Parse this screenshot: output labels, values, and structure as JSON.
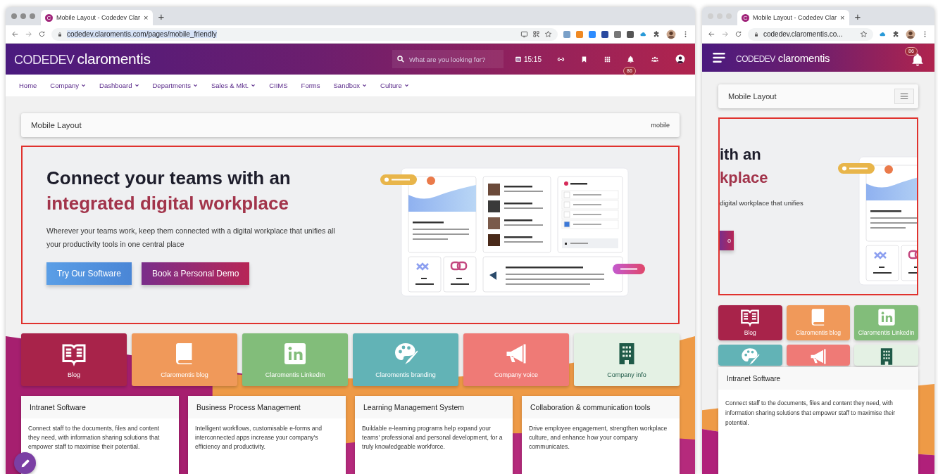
{
  "windows": [
    {
      "kind": "desktop",
      "tab": {
        "favicon": "C",
        "title": "Mobile Layout - Codedev Clar",
        "close": "×",
        "selected": true
      },
      "new_tab": "+",
      "url": "codedev.claromentis.com/pages/mobile_friendly",
      "header": {
        "logo_prefix": "CODEDEV",
        "logo_name": "claromentis",
        "search_placeholder": "What are you looking for?",
        "clock": "15:15",
        "badge": "86"
      },
      "nav": [
        {
          "label": "Home",
          "dropdown": false
        },
        {
          "label": "Company",
          "dropdown": true
        },
        {
          "label": "Dashboard",
          "dropdown": true
        },
        {
          "label": "Departments",
          "dropdown": true
        },
        {
          "label": "Sales & Mkt.",
          "dropdown": true
        },
        {
          "label": "CIIMS",
          "dropdown": false
        },
        {
          "label": "Forms",
          "dropdown": false
        },
        {
          "label": "Sandbox",
          "dropdown": true
        },
        {
          "label": "Culture",
          "dropdown": true
        }
      ],
      "page_header": {
        "title": "Mobile Layout",
        "tag": "mobile"
      },
      "hero": {
        "heading": [
          "Connect your teams with an",
          "integrated digital workplace"
        ],
        "text": "Wherever your teams work, keep them connected with a digital workplace that unifies all your productivity tools in one central place",
        "buttons": [
          {
            "label": "Try Our Software",
            "kind": "primary"
          },
          {
            "label": "Book a Personal Demo",
            "kind": "accent"
          }
        ]
      },
      "tiles": [
        {
          "label": "Blog",
          "color": "#a8234a"
        },
        {
          "label": "Claromentis blog",
          "color": "#f0995a"
        },
        {
          "label": "Claromentis LinkedIn",
          "color": "#82bd7a"
        },
        {
          "label": "Claromentis branding",
          "color": "#62b3b6"
        },
        {
          "label": "Company voice",
          "color": "#ef7a76"
        },
        {
          "label": "Company info",
          "color": "#e4f1e4"
        }
      ],
      "cards": [
        {
          "title": "Intranet Software",
          "text": "Connect staff to the documents, files and content they need, with information sharing solutions that empower staff to maximise their potential."
        },
        {
          "title": "Business Process Management",
          "text": "Intelligent workflows, customisable e-forms and interconnected apps increase your company's efficiency and productivity."
        },
        {
          "title": "Learning Management System",
          "text": "Buildable e-learning programs help expand your teams' professional and personal development, for a truly knowledgeable workforce."
        },
        {
          "title": "Collaboration & communication tools",
          "text": "Drive employee engagement, strengthen workplace culture, and enhance how your company communicates."
        }
      ]
    },
    {
      "kind": "mobile",
      "tab": {
        "favicon": "C",
        "title": "Mobile Layout - Codedev Clar",
        "close": "×",
        "selected": true
      },
      "new_tab": "+",
      "url": "codedev.claromentis.co...",
      "header": {
        "logo_prefix": "CODEDEV",
        "logo_name": "claromentis",
        "badge": "86"
      },
      "page_header": {
        "title": "Mobile Layout"
      },
      "hero": {
        "heading": [
          "ith an",
          "kplace"
        ],
        "text": "digital workplace that unifies",
        "buttons": [
          {
            "label": "o",
            "kind": "accent"
          }
        ]
      },
      "tiles": [
        {
          "label": "Blog",
          "color": "#a8234a"
        },
        {
          "label": "Claromentis blog",
          "color": "#f0995a"
        },
        {
          "label": "Claromentis LinkedIn",
          "color": "#82bd7a"
        },
        {
          "color": "#62b3b6"
        },
        {
          "color": "#ef7a76"
        },
        {
          "color": "#e4f1e4"
        }
      ],
      "cards": [
        {
          "title": "Intranet Software",
          "text": "Connect staff to the documents, files and content they need, with information sharing solutions that empower staff to maximise their potential."
        }
      ]
    }
  ]
}
